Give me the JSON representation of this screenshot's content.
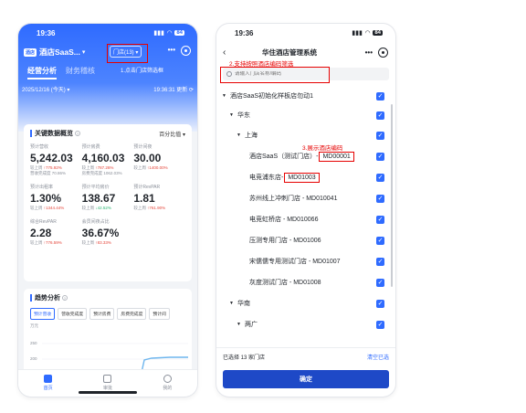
{
  "left": {
    "status_time": "19:36",
    "battery": "84",
    "logo_text": "酒店",
    "app_title": "酒店SaaS...",
    "store_select": "门店(13)",
    "annotation_1": "1.点击门店筛选框",
    "tabs": [
      {
        "label": "经营分析"
      },
      {
        "label": "财务稽核"
      }
    ],
    "date": "2025/12/16 (今天)",
    "refresh_time": "19:36:31 更新",
    "kpi_title": "关键数据概览",
    "kpi_compare": "百分比值",
    "kpis": [
      {
        "label": "预计营收",
        "value": "5,242.03",
        "sub1_prefix": "较上周",
        "sub1_val": "↑775.92%",
        "sub2": "营收完成度 70.86%"
      },
      {
        "label": "预计房费",
        "value": "4,160.03",
        "sub1_prefix": "较上周",
        "sub1_val": "↑787.26%",
        "sub2": "房费完成度 1062.03%"
      },
      {
        "label": "预计间夜",
        "value": "30.00",
        "sub1_prefix": "较上周",
        "sub1_val": "↑1400.00%",
        "sub2": ""
      },
      {
        "label": "预计出租率",
        "value": "1.30%",
        "sub1_prefix": "较上周",
        "sub1_val": "↑1344.44%",
        "sub2": ""
      },
      {
        "label": "预计平均房价",
        "value": "138.67",
        "sub1_prefix": "较上周",
        "sub1_val": "↓42.52%",
        "sub2": ""
      },
      {
        "label": "预计RevPAR",
        "value": "1.81",
        "sub1_prefix": "较上周",
        "sub1_val": "↑761.90%",
        "sub2": ""
      },
      {
        "label": "综合RevPAR",
        "value": "2.28",
        "sub1_prefix": "较上周",
        "sub1_val": "↑776.59%",
        "sub2": ""
      },
      {
        "label": "会员间夜占比",
        "value": "36.67%",
        "sub1_prefix": "较上周",
        "sub1_val": "↑83.33%",
        "sub2": ""
      }
    ],
    "trend_title": "趋势分析",
    "trend_tabs": [
      "预计营收",
      "营收完成度",
      "预计房费",
      "房费完成度",
      "预计间"
    ],
    "trend_unit": "万元",
    "trend_ticks": [
      "250",
      "200",
      "150"
    ],
    "tabbar": [
      {
        "label": "首页"
      },
      {
        "label": "审批"
      },
      {
        "label": "我的"
      }
    ]
  },
  "right": {
    "status_time": "19:36",
    "battery": "84",
    "title": "华住酒店管理系统",
    "annotation_2": "2.支持按照酒店编码筛选",
    "annotation_3": "3.展示酒店编码",
    "search_placeholder": "请输入门店名称/编码",
    "tree": [
      {
        "level": 0,
        "text": "酒店SaaS初始化样板店勿动1"
      },
      {
        "level": 1,
        "text": "华东"
      },
      {
        "level": 2,
        "text": "上海"
      },
      {
        "level": 3,
        "text": "酒店SaaS（测试门店）- ",
        "code": "MD00001"
      },
      {
        "level": 3,
        "text": "电竞浦东店- ",
        "code": "MD01003"
      },
      {
        "level": 3,
        "text": "苏州线上冲刺门店 - MD010041"
      },
      {
        "level": 3,
        "text": "电竞虹桥店 - MD010066"
      },
      {
        "level": 3,
        "text": "压测专用门店 - MD01006"
      },
      {
        "level": 3,
        "text": "宋儒儒专用测试门店 - MD01007"
      },
      {
        "level": 3,
        "text": "灰度测试门店 - MD01008"
      },
      {
        "level": 1,
        "text": "华南"
      },
      {
        "level": 2,
        "text": "两广"
      }
    ],
    "footer_selected": "已选择 13 家门店",
    "footer_clear": "清空已选",
    "confirm_label": "确定"
  }
}
